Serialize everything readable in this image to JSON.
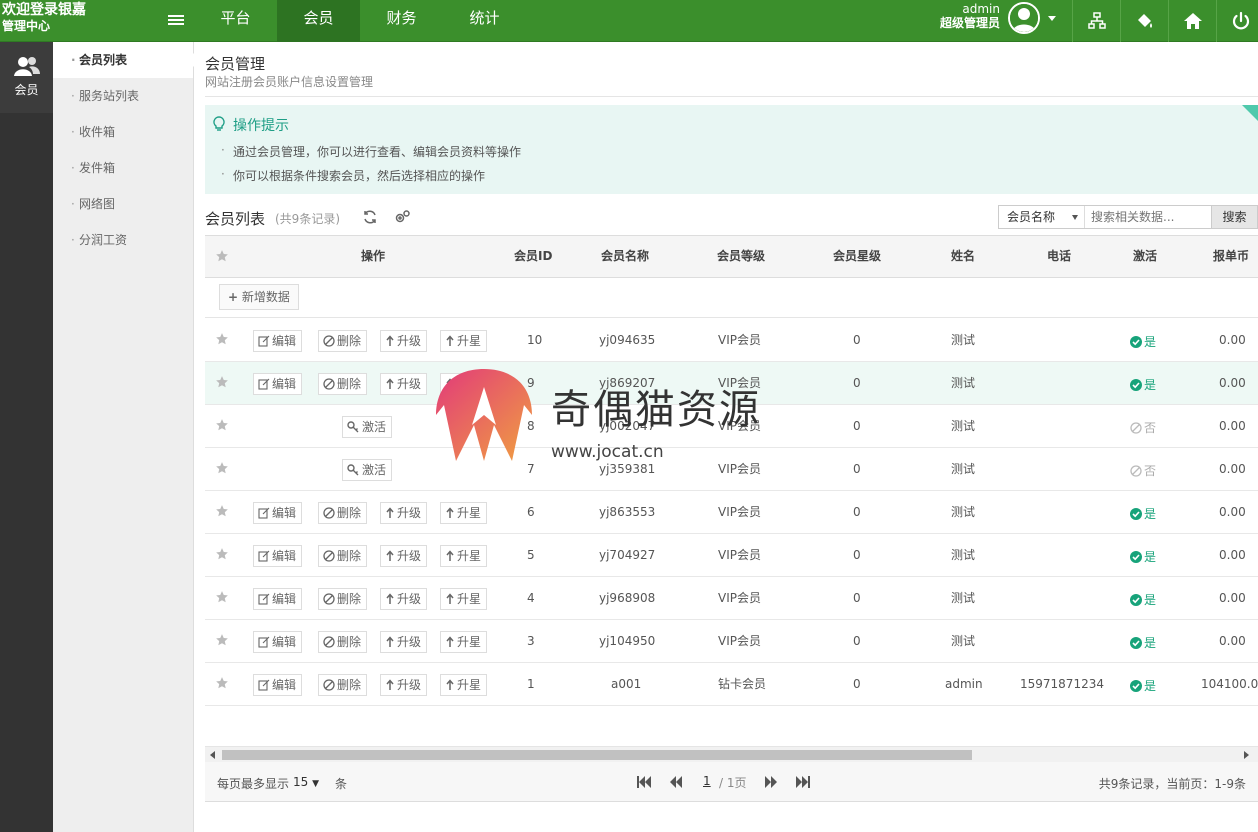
{
  "brand": {
    "title": "欢迎登录银嘉",
    "subtitle": "管理中心"
  },
  "nav": [
    "平台",
    "会员",
    "财务",
    "统计"
  ],
  "user": {
    "name": "admin",
    "role": "超级管理员"
  },
  "sidebar_main": {
    "label": "会员"
  },
  "sidebar_sub": [
    "会员列表",
    "服务站列表",
    "收件箱",
    "发件箱",
    "网络图",
    "分润工资"
  ],
  "page": {
    "title": "会员管理",
    "subtitle": "网站注册会员账户信息设置管理"
  },
  "tips": {
    "title": "操作提示",
    "lines": [
      "通过会员管理，你可以进行查看、编辑会员资料等操作",
      "你可以根据条件搜索会员，然后选择相应的操作"
    ]
  },
  "list": {
    "title": "会员列表",
    "count": "(共9条记录)"
  },
  "search": {
    "field": "会员名称",
    "placeholder": "搜索相关数据...",
    "button": "搜索"
  },
  "table": {
    "headers": [
      "操作",
      "会员ID",
      "会员名称",
      "会员等级",
      "会员星级",
      "姓名",
      "电话",
      "激活",
      "报单币"
    ],
    "add_label": "新增数据",
    "op_labels": {
      "edit": "编辑",
      "delete": "删除",
      "upgrade": "升级",
      "star": "升星",
      "activate": "激活"
    },
    "rows": [
      {
        "id": "10",
        "name": "yj094635",
        "level": "VIP会员",
        "stars": "0",
        "realname": "测试",
        "phone": "",
        "active": "是",
        "coin": "0.00",
        "ops": "full"
      },
      {
        "id": "9",
        "name": "yj869207",
        "level": "VIP会员",
        "stars": "0",
        "realname": "测试",
        "phone": "",
        "active": "是",
        "coin": "0.00",
        "ops": "full"
      },
      {
        "id": "8",
        "name": "yj002047",
        "level": "VIP会员",
        "stars": "0",
        "realname": "测试",
        "phone": "",
        "active": "否",
        "coin": "0.00",
        "ops": "activate"
      },
      {
        "id": "7",
        "name": "yj359381",
        "level": "VIP会员",
        "stars": "0",
        "realname": "测试",
        "phone": "",
        "active": "否",
        "coin": "0.00",
        "ops": "activate"
      },
      {
        "id": "6",
        "name": "yj863553",
        "level": "VIP会员",
        "stars": "0",
        "realname": "测试",
        "phone": "",
        "active": "是",
        "coin": "0.00",
        "ops": "full"
      },
      {
        "id": "5",
        "name": "yj704927",
        "level": "VIP会员",
        "stars": "0",
        "realname": "测试",
        "phone": "",
        "active": "是",
        "coin": "0.00",
        "ops": "full"
      },
      {
        "id": "4",
        "name": "yj968908",
        "level": "VIP会员",
        "stars": "0",
        "realname": "测试",
        "phone": "",
        "active": "是",
        "coin": "0.00",
        "ops": "full"
      },
      {
        "id": "3",
        "name": "yj104950",
        "level": "VIP会员",
        "stars": "0",
        "realname": "测试",
        "phone": "",
        "active": "是",
        "coin": "0.00",
        "ops": "full"
      },
      {
        "id": "1",
        "name": "a001",
        "level": "钻卡会员",
        "stars": "0",
        "realname": "admin",
        "phone": "15971871234",
        "active": "是",
        "coin": "104100.0",
        "ops": "full"
      }
    ]
  },
  "pager": {
    "per_page_label": "每页最多显示",
    "per_page": "15",
    "unit": "条",
    "current": "1",
    "total": "/ 1页",
    "info": "共9条记录，当前页：1-9条"
  },
  "watermark": {
    "text": "奇偶猫资源",
    "url": "www.jocat.cn"
  },
  "colors": {
    "topbar": "#3b8f2c",
    "accent": "#17a37a",
    "tips_bg": "#e8f6f3"
  }
}
